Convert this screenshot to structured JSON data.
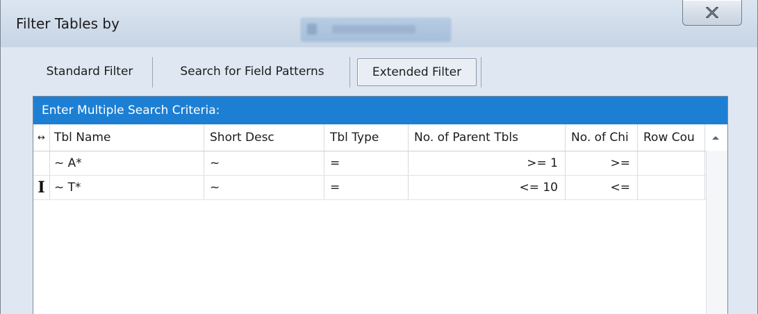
{
  "window": {
    "title": "Filter Tables by",
    "close_label": "X"
  },
  "tabs": [
    {
      "label": "Standard Filter",
      "active": false
    },
    {
      "label": "Search for Field Patterns",
      "active": false
    },
    {
      "label": "Extended Filter",
      "active": true
    }
  ],
  "panel": {
    "header": "Enter Multiple Search Criteria:"
  },
  "grid": {
    "columns": [
      "Tbl Name",
      "Short Desc",
      "Tbl Type",
      "No. of Parent Tbls",
      "No. of Chi",
      "Row Cou"
    ],
    "rows": [
      {
        "tbl_name": "~  A*",
        "short_desc": "~",
        "tbl_type": "=",
        "parent_tbls": ">=  1",
        "child_tbls": ">=",
        "row_count": "",
        "indicator": ""
      },
      {
        "tbl_name": "~  T*",
        "short_desc": "~",
        "tbl_type": "=",
        "parent_tbls": "<=  10",
        "child_tbls": "<=",
        "row_count": "",
        "indicator": "I"
      }
    ]
  },
  "icons": {
    "row_header": "resize-horizontal-icon",
    "scroll_up": "scroll-up-arrow-icon",
    "close": "close-icon"
  },
  "colors": {
    "panel_header_bg": "#1d7fd3",
    "window_bg": "#dfe8f2"
  }
}
